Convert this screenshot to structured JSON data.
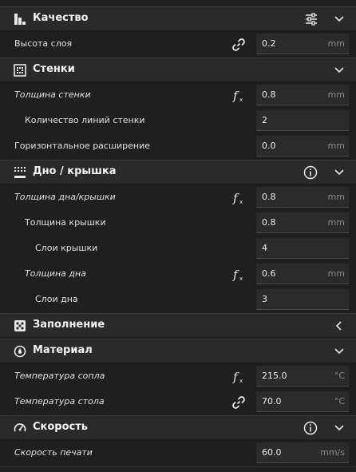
{
  "sections": {
    "quality": {
      "title": "Качество",
      "icon": "quality-bars-icon",
      "action_icon": "sliders-icon",
      "rows": [
        {
          "label": "Высота слоя",
          "value": "0.2",
          "unit": "mm",
          "icon": "link-icon"
        }
      ]
    },
    "walls": {
      "title": "Стенки",
      "icon": "walls-icon",
      "rows": [
        {
          "label": "Толщина стенки",
          "value": "0.8",
          "unit": "mm",
          "icon": "function-icon"
        },
        {
          "label": "Количество линий стенки",
          "value": "2",
          "unit": ""
        },
        {
          "label": "Горизонтальное расширение",
          "value": "0.0",
          "unit": "mm"
        }
      ]
    },
    "top_bottom": {
      "title": "Дно / крышка",
      "icon": "top-bottom-icon",
      "action_icon": "info-icon",
      "rows": [
        {
          "label": "Толщина дна/крышки",
          "value": "0.8",
          "unit": "mm",
          "icon": "function-icon"
        },
        {
          "label": "Толщина крышки",
          "value": "0.8",
          "unit": "mm"
        },
        {
          "label": "Слои крышки",
          "value": "4",
          "unit": ""
        },
        {
          "label": "Толщина дна",
          "value": "0.6",
          "unit": "mm",
          "icon": "function-icon"
        },
        {
          "label": "Слои дна",
          "value": "3",
          "unit": ""
        }
      ]
    },
    "infill": {
      "title": "Заполнение",
      "icon": "infill-icon"
    },
    "material": {
      "title": "Материал",
      "icon": "material-icon",
      "rows": [
        {
          "label": "Температура сопла",
          "value": "215.0",
          "unit": "°C",
          "icon": "function-icon"
        },
        {
          "label": "Температура стола",
          "value": "70.0",
          "unit": "°C",
          "icon": "link-icon"
        }
      ]
    },
    "speed": {
      "title": "Скорость",
      "icon": "speed-icon",
      "action_icon": "info-icon",
      "rows": [
        {
          "label": "Скорость печати",
          "value": "60.0",
          "unit": "mm/s"
        }
      ]
    }
  },
  "colors": {
    "background": "#1f1f1f",
    "category_bar": "#2a2a2a",
    "field": "#2b2b2b",
    "text": "#e6e6e6",
    "unit": "#8a8a8a"
  }
}
